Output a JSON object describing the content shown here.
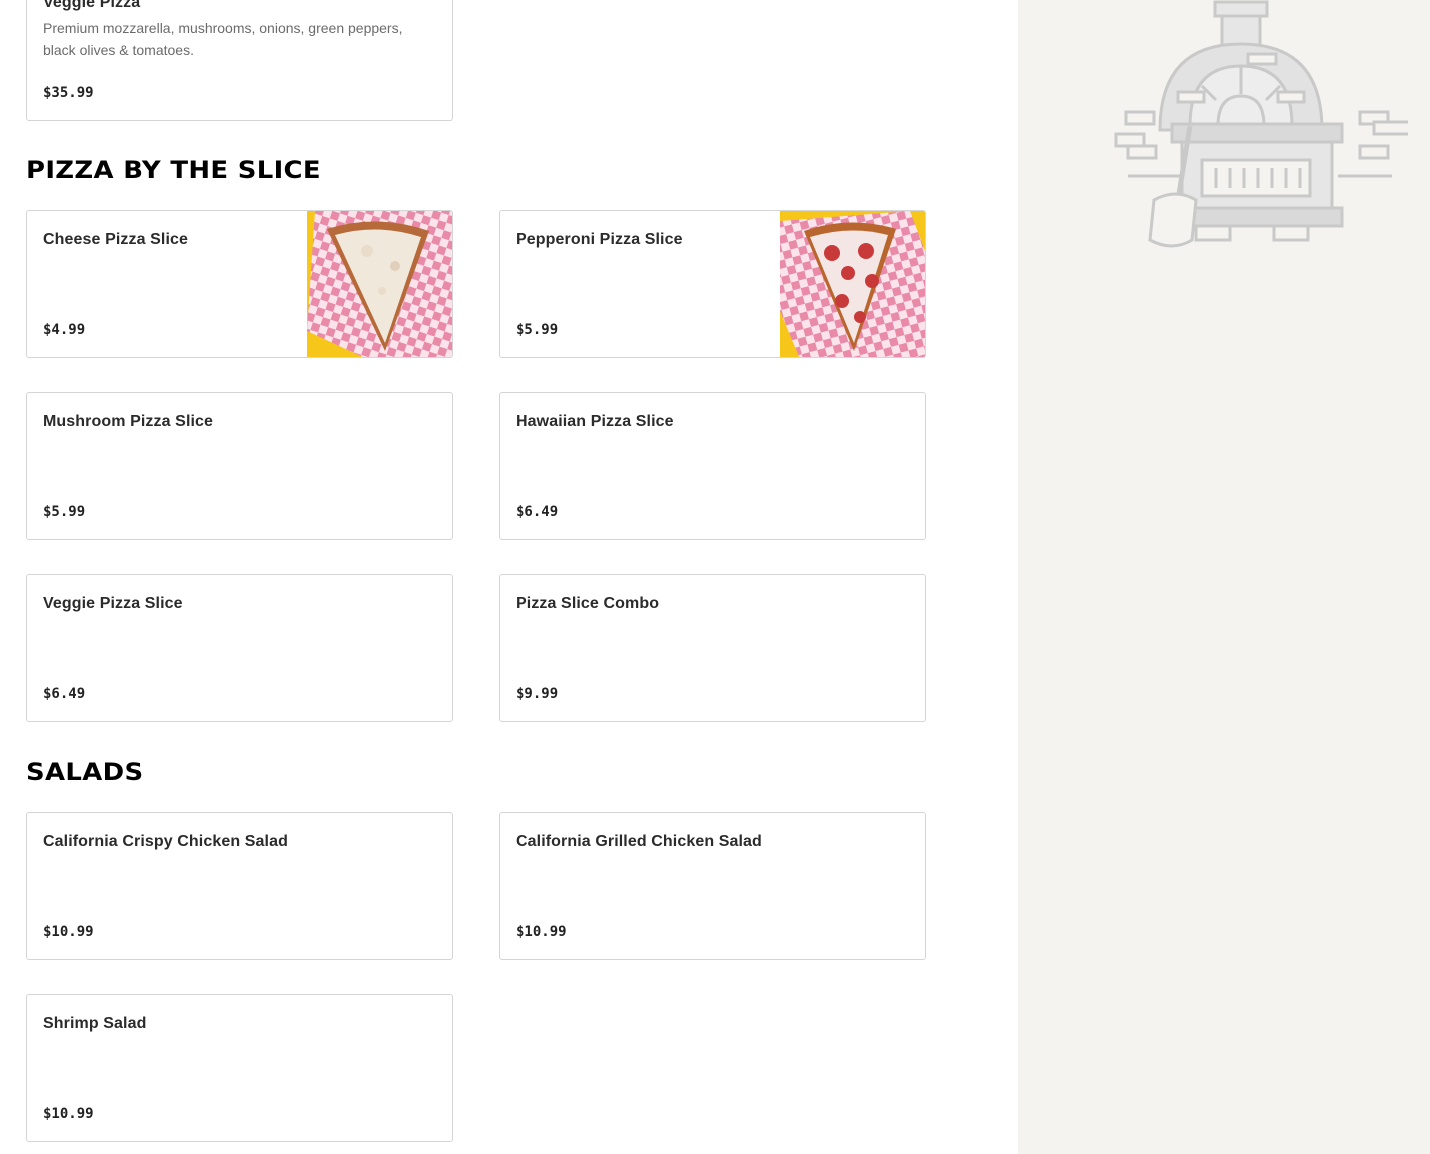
{
  "pizzas": {
    "veggie": {
      "name": "Veggie Pizza",
      "description": "Premium mozzarella, mushrooms, onions, green peppers, black olives & tomatoes.",
      "price": "$35.99"
    }
  },
  "slices": {
    "title": "PIZZA BY THE SLICE",
    "items": [
      {
        "name": "Cheese Pizza Slice",
        "price": "$4.99",
        "image": "cheese-slice-photo"
      },
      {
        "name": "Pepperoni Pizza Slice",
        "price": "$5.99",
        "image": "pepperoni-slice-photo"
      },
      {
        "name": "Mushroom Pizza Slice",
        "price": "$5.99"
      },
      {
        "name": "Hawaiian Pizza Slice",
        "price": "$6.49"
      },
      {
        "name": "Veggie Pizza Slice",
        "price": "$6.49"
      },
      {
        "name": "Pizza Slice Combo",
        "price": "$9.99"
      }
    ]
  },
  "salads": {
    "title": "SALADS",
    "items": [
      {
        "name": "California Crispy Chicken Salad",
        "price": "$10.99"
      },
      {
        "name": "California Grilled Chicken Salad",
        "price": "$10.99"
      },
      {
        "name": "Shrimp Salad",
        "price": "$10.99"
      }
    ]
  },
  "colors": {
    "sidebar_bg": "#f4f3f0",
    "card_border": "#d5d5d5",
    "photo_bg": "#f6c71a",
    "checker_pink": "#e88aa8"
  },
  "sidebar": {
    "illustration": "pizza-oven-illustration"
  }
}
